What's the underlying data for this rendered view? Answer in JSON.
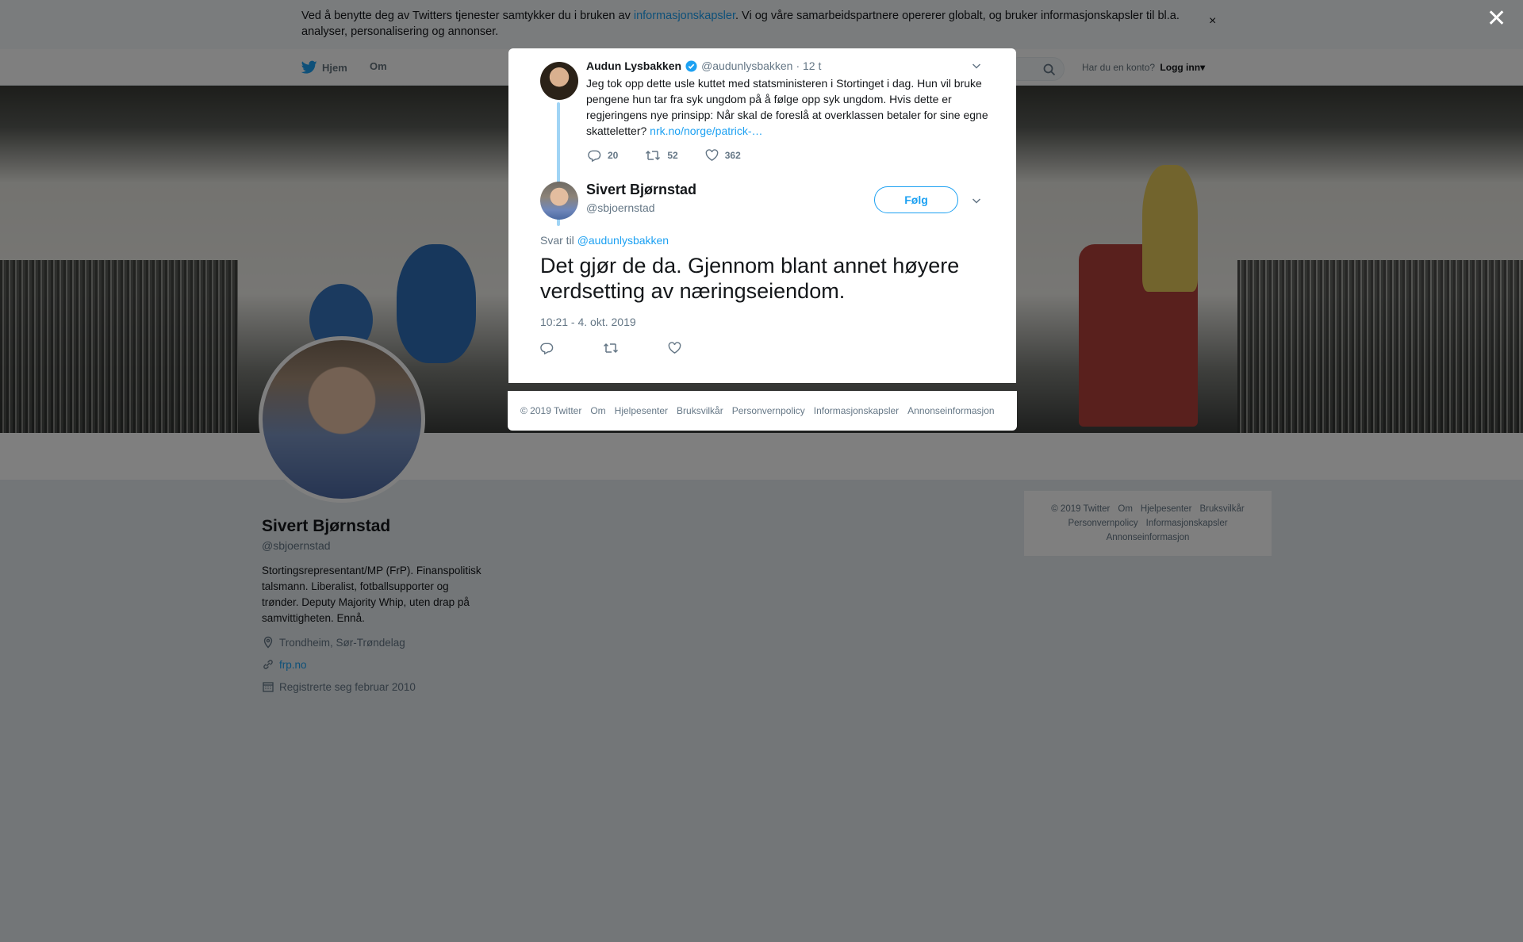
{
  "cookie": {
    "text_before": "Ved å benytte deg av Twitters tjenester samtykker du i bruken av ",
    "link": "informasjonskapsler",
    "text_after": ". Vi og våre samarbeidspartnere opererer globalt, og bruker informasjonskapsler til bl.a. analyser, personalisering og annonser.",
    "close": "×"
  },
  "nav": {
    "home": "Hjem",
    "about": "Om",
    "login_prompt": "Har du en konto?",
    "login": "Logg inn",
    "login_caret": "▾"
  },
  "profile": {
    "name": "Sivert Bjørnstad",
    "handle": "@sbjoernstad",
    "bio": "Stortingsrepresentant/MP (FrP). Finanspolitisk talsmann. Liberalist, fotballsupporter og trønder. Deputy Majority Whip, uten drap på samvittigheten. Ennå.",
    "location": "Trondheim, Sør-Trøndelag",
    "website": "frp.no",
    "joined": "Registrerte seg februar 2010"
  },
  "side_footer": {
    "items": [
      "© 2019 Twitter",
      "Om",
      "Hjelpesenter",
      "Bruksvilkår",
      "Personvernpolicy",
      "Informasjonskapsler",
      "Annonseinformasjon"
    ]
  },
  "overlay": {
    "close": "✕"
  },
  "parent_tweet": {
    "name": "Audun Lysbakken",
    "handle": "@audunlysbakken",
    "time": "· 12 t",
    "text": "Jeg tok opp dette usle kuttet med statsministeren i Stortinget i dag. Hun vil bruke pengene hun tar fra syk ungdom på å følge opp syk ungdom. Hvis dette er regjeringens nye prinsipp: Når skal de foreslå at overklassen betaler for sine egne skatteletter? ",
    "link": "nrk.no/norge/patrick-…",
    "replies": "20",
    "retweets": "52",
    "likes": "362"
  },
  "main_tweet": {
    "name": "Sivert Bjørnstad",
    "handle": "@sbjoernstad",
    "follow": "Følg",
    "reply_prefix": "Svar til ",
    "reply_handle": "@audunlysbakken",
    "text": "Det gjør de da. Gjennom blant annet høyere verdsetting av næringseiendom.",
    "timestamp": "10:21 - 4. okt. 2019"
  },
  "modal_footer": {
    "items": [
      "© 2019 Twitter",
      "Om",
      "Hjelpesenter",
      "Bruksvilkår",
      "Personvernpolicy",
      "Informasjonskapsler",
      "Annonseinformasjon"
    ]
  },
  "colors": {
    "accent": "#1da1f2",
    "verified": "#1da1f2",
    "muted": "#657786",
    "page_bg": "#e6ecf0"
  },
  "icons": [
    "twitter-bird-icon",
    "search-icon",
    "verified-icon",
    "chevron-down-icon",
    "reply-icon",
    "retweet-icon",
    "like-icon",
    "location-icon",
    "link-icon",
    "calendar-icon",
    "close-icon"
  ]
}
